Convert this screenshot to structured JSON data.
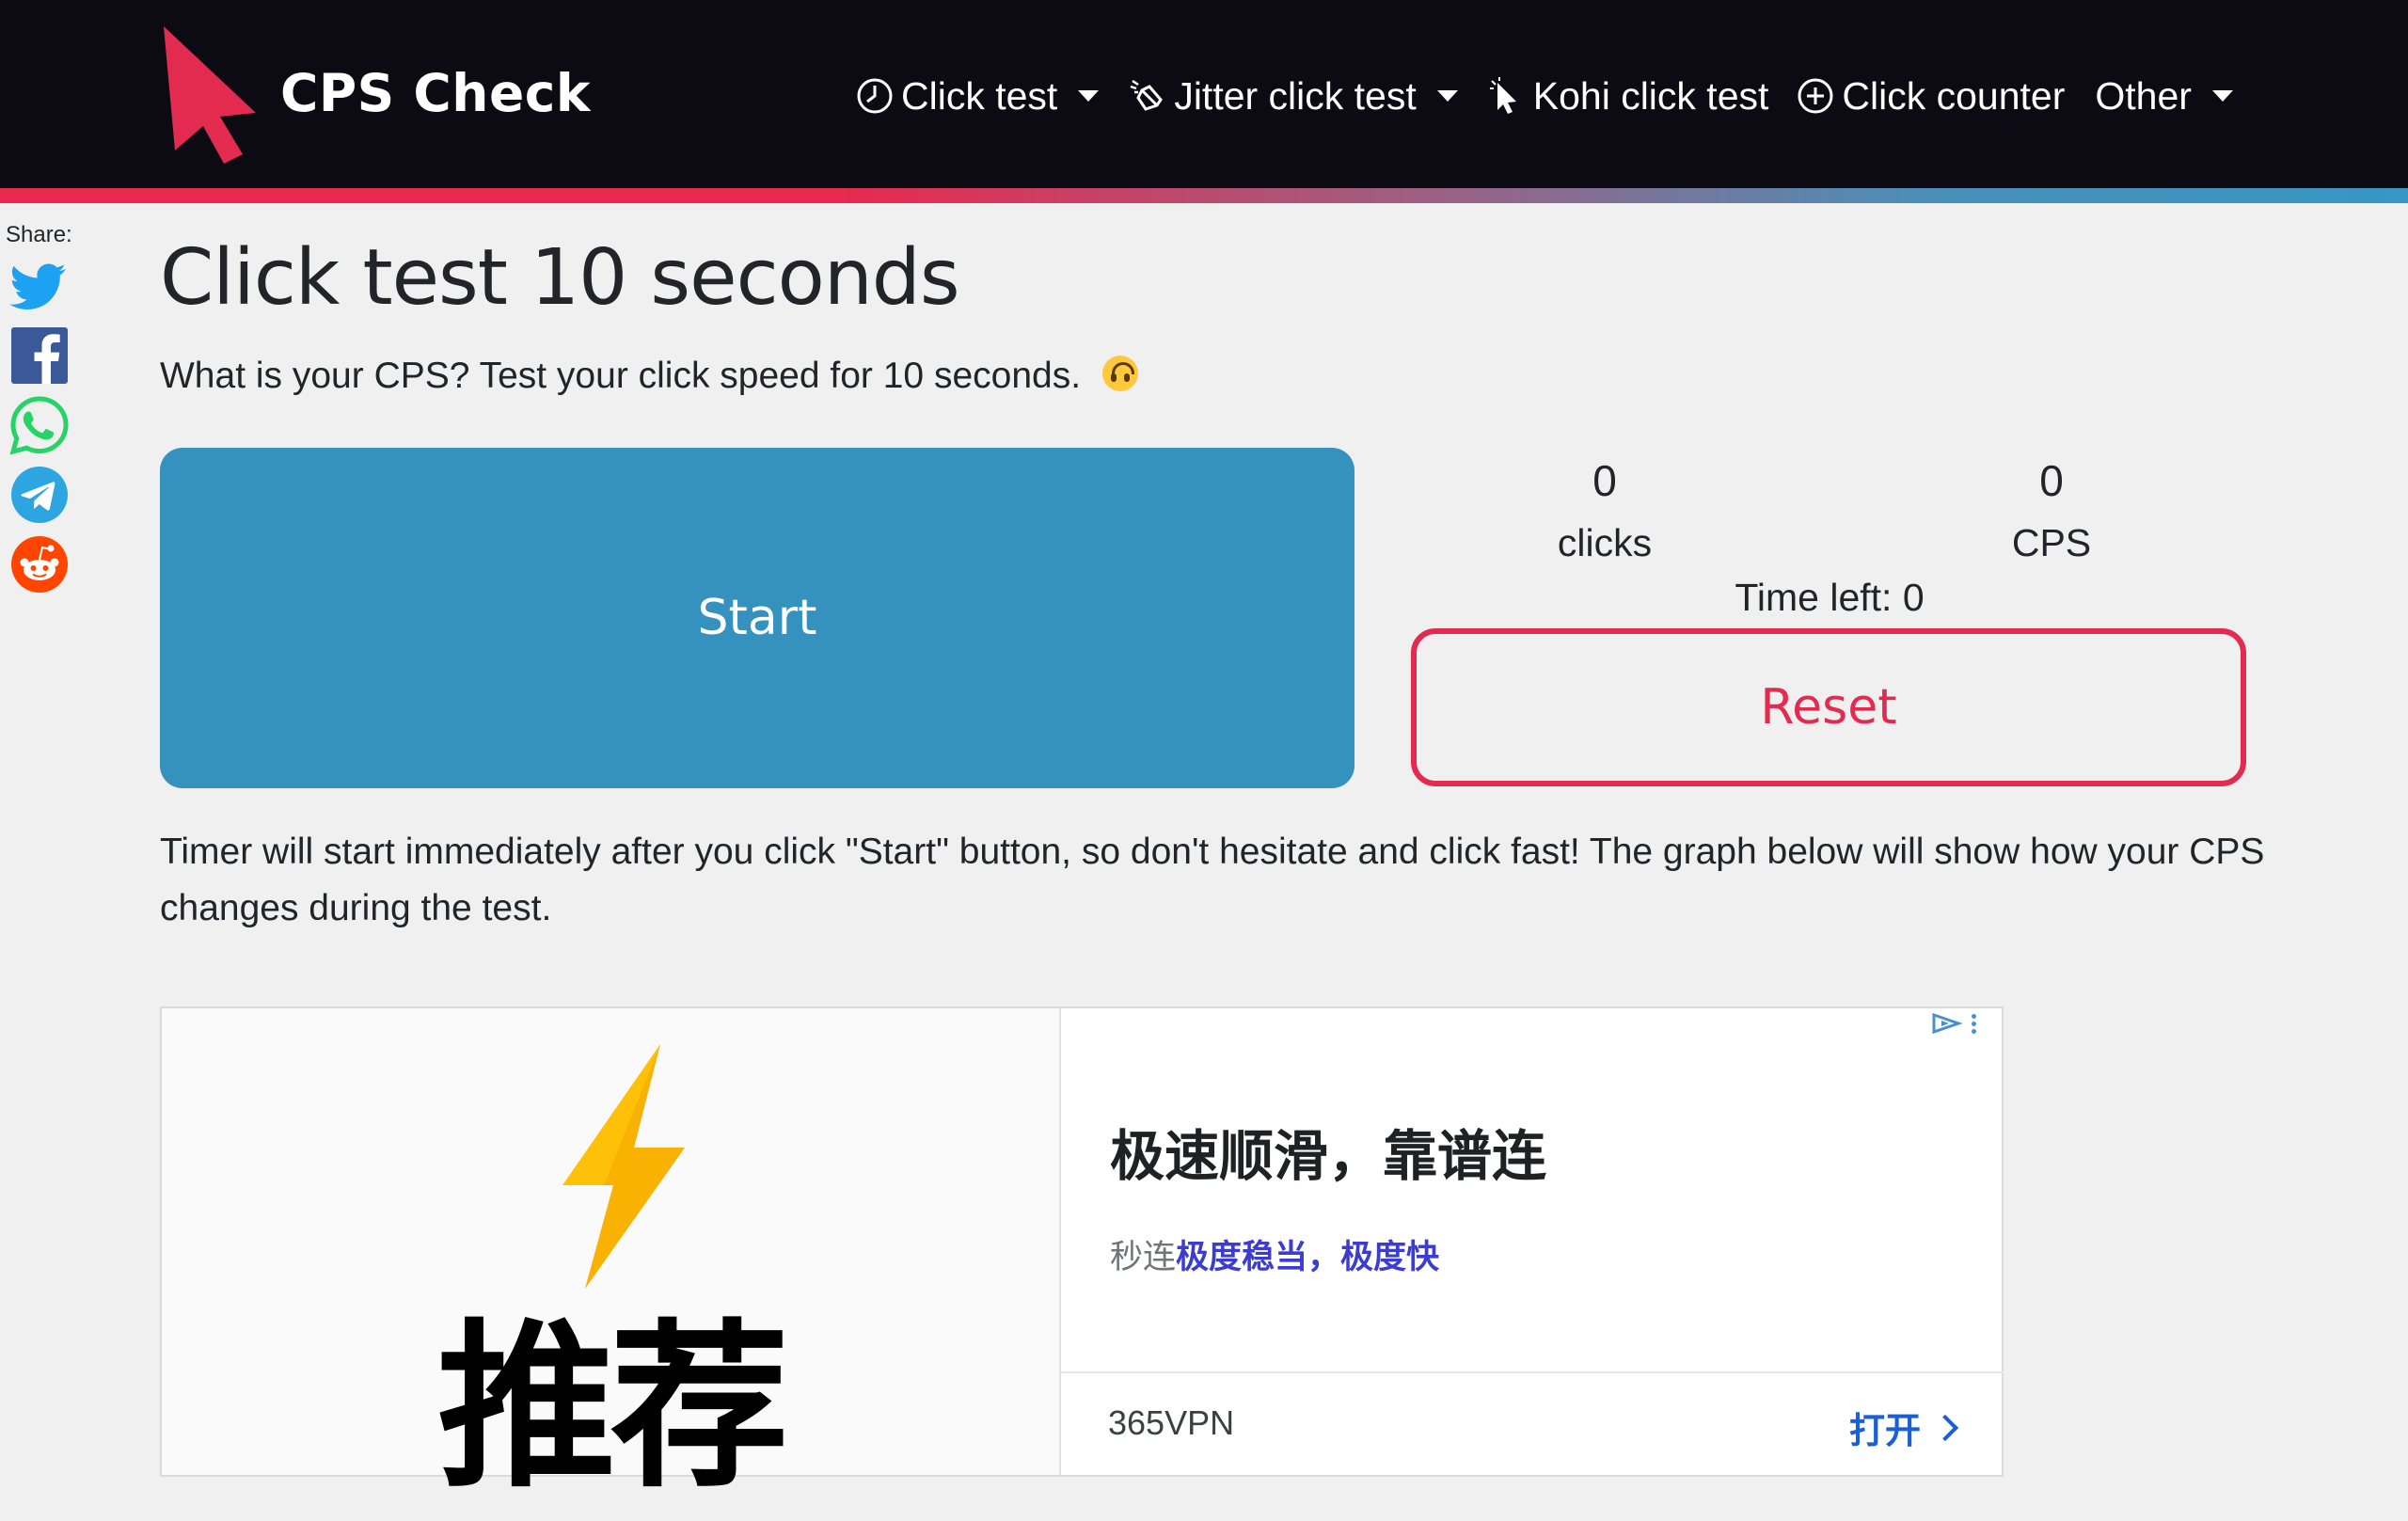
{
  "nav": {
    "brand": "CPS Check",
    "items": [
      {
        "label": "Click test",
        "icon": "clock-icon",
        "dropdown": true
      },
      {
        "label": "Jitter click test",
        "icon": "jitter-hand-icon",
        "dropdown": true
      },
      {
        "label": "Kohi click test",
        "icon": "cursor-icon",
        "dropdown": false
      },
      {
        "label": "Click counter",
        "icon": "plus-circle-icon",
        "dropdown": false
      },
      {
        "label": "Other",
        "icon": "",
        "dropdown": true
      }
    ]
  },
  "share": {
    "label": "Share:",
    "icons": [
      "twitter-icon",
      "facebook-icon",
      "whatsapp-icon",
      "telegram-icon",
      "reddit-icon"
    ]
  },
  "page": {
    "title": "Click test 10 seconds",
    "subtitle": "What is your CPS? Test your click speed for 10 seconds.",
    "start_label": "Start",
    "reset_label": "Reset",
    "clicks_value": "0",
    "clicks_label": "clicks",
    "cps_value": "0",
    "cps_label": "CPS",
    "time_left": "Time left: 0",
    "info": "Timer will start immediately after you click \"Start\" button, so don't hesitate and click fast! The graph below will show how your CPS changes during the test."
  },
  "ad": {
    "image_text": "推荐",
    "headline": "极速顺滑，靠谱连",
    "desc_plain": "秒连",
    "desc_bold": "极度稳当，极度快",
    "advertiser": "365VPN",
    "cta": "打开"
  },
  "colors": {
    "accent_red": "#e32a4f",
    "start_blue": "#3591be",
    "navbar_bg": "#0c0b14"
  }
}
